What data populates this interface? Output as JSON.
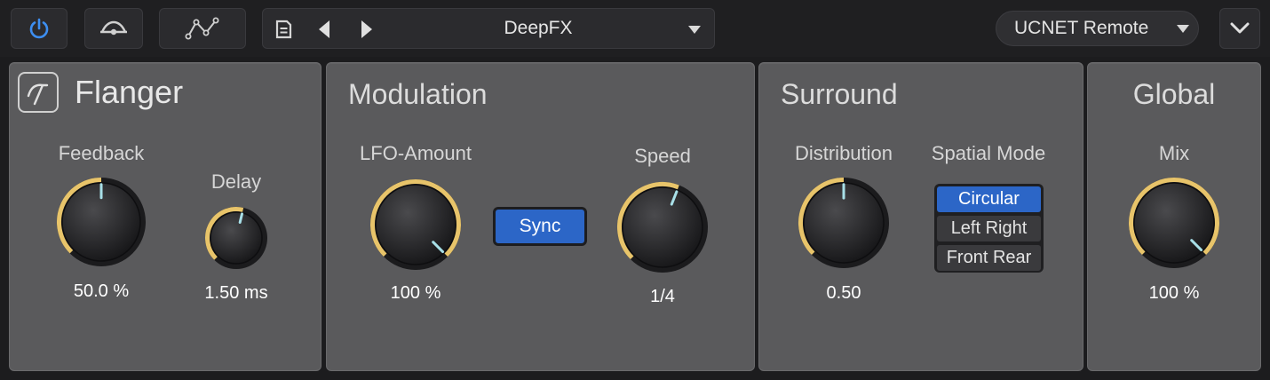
{
  "toolbar": {
    "power_icon": "power-icon",
    "curve_icon": "compare-curve-icon",
    "automation_icon": "automation-icon",
    "preset_icon": "preset-file-icon",
    "preset_name": "DeepFX",
    "remote_label": "UCNET Remote",
    "accent": "#3d8ef0"
  },
  "flanger": {
    "title": "Flanger",
    "feedback": {
      "label": "Feedback",
      "value": "50.0 %",
      "level": 0.5
    },
    "delay": {
      "label": "Delay",
      "value": "1.50 ms",
      "level": 0.55
    }
  },
  "modulation": {
    "title": "Modulation",
    "lfo": {
      "label": "LFO-Amount",
      "value": "100 %",
      "level": 1.0
    },
    "sync_label": "Sync",
    "speed": {
      "label": "Speed",
      "value": "1/4",
      "level": 0.58
    }
  },
  "surround": {
    "title": "Surround",
    "distribution": {
      "label": "Distribution",
      "value": "0.50",
      "level": 0.5
    },
    "spatial_mode_label": "Spatial Mode",
    "modes": [
      "Circular",
      "Left Right",
      "Front Rear"
    ],
    "selected_mode": "Circular"
  },
  "global": {
    "title": "Global",
    "mix": {
      "label": "Mix",
      "value": "100 %",
      "level": 1.0
    }
  },
  "colors": {
    "arc": "#e8c46a",
    "pointer": "#a8e0e8",
    "selected": "#2c66c7",
    "panel": "#5a5a5c"
  }
}
